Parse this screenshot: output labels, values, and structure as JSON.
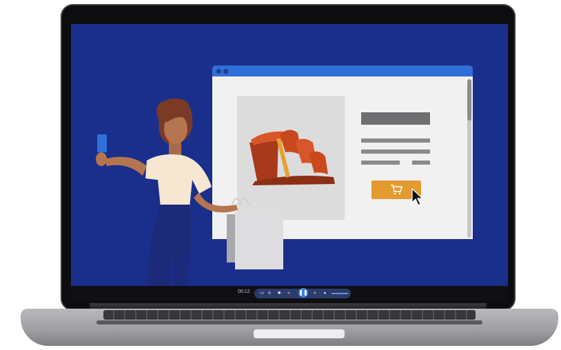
{
  "colors": {
    "screen_bg": "#1a2f8c",
    "browser_titlebar": "#2f6fd8",
    "cart_button": "#e39a2e",
    "shoe": "#c9491d"
  },
  "player": {
    "time_label": "00:12",
    "controls": [
      "captions-icon",
      "settings-icon",
      "stop-icon",
      "rewind-icon",
      "pause-icon",
      "forward-icon",
      "volume-icon"
    ],
    "state": "playing"
  },
  "browser": {
    "product_image": "wedge-sandal-icon",
    "add_to_cart": "cart-icon"
  },
  "illustration": {
    "card": "credit-card-icon",
    "bags": "shopping-bag-icon"
  }
}
